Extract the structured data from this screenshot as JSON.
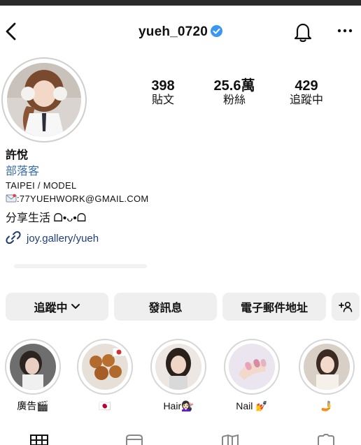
{
  "header": {
    "username": "yueh_0720",
    "icons": {
      "back": "chevron-left-icon",
      "bell": "bell-icon",
      "more": "more-dots-icon",
      "verified": "verified-badge-icon"
    }
  },
  "stats": [
    {
      "value": "398",
      "label": "貼文"
    },
    {
      "value": "25.6萬",
      "label": "粉絲"
    },
    {
      "value": "429",
      "label": "追蹤中"
    }
  ],
  "profile": {
    "name": "許悅",
    "category": "部落客",
    "bio_line1": "TAIPEI / MODEL",
    "bio_line2": ":77YUEHWORK@GMAIL.COM",
    "bio_line3": "分享生活 ᗝ•ᴗ•ᗝ",
    "link": "joy.gallery/yueh"
  },
  "buttons": {
    "following": "追蹤中",
    "message": "發訊息",
    "email": "電子郵件地址"
  },
  "highlights": [
    {
      "caption": "廣告🎬"
    },
    {
      "caption": "🇯🇵"
    },
    {
      "caption": "Hair💇🏻‍♀️"
    },
    {
      "caption": "Nail 💅"
    },
    {
      "caption": "🤳"
    }
  ],
  "colors": {
    "verified": "#3897f0",
    "category": "#3b6ea8",
    "link": "#1f3e79",
    "button_bg": "#efefef"
  }
}
